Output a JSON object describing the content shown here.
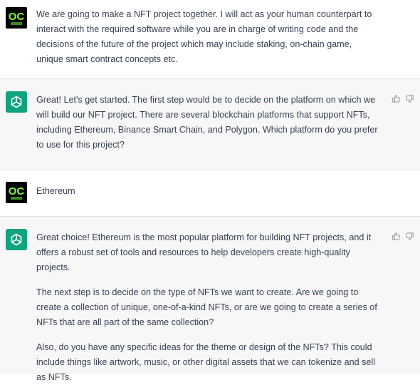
{
  "conversation": {
    "messages": [
      {
        "role": "user",
        "avatar": "user-avatar-oc",
        "paragraphs": [
          "We are going to make a NFT project together. I will act as your human counterpart to interact with the required software while you are in charge of writing code and the decisions of the future of the project which may include staking, on-chain game, unique smart contract concepts etc."
        ]
      },
      {
        "role": "assistant",
        "avatar": "chatgpt-logo-icon",
        "paragraphs": [
          "Great! Let's get started. The first step would be to decide on the platform on which we will build our NFT project. There are several blockchain platforms that support NFTs, including Ethereum, Binance Smart Chain, and Polygon. Which platform do you prefer to use for this project?"
        ]
      },
      {
        "role": "user",
        "avatar": "user-avatar-oc",
        "paragraphs": [
          "Ethereum"
        ]
      },
      {
        "role": "assistant",
        "avatar": "chatgpt-logo-icon",
        "paragraphs": [
          "Great choice! Ethereum is the most popular platform for building NFT projects, and it offers a robust set of tools and resources to help developers create high-quality projects.",
          "The next step is to decide on the type of NFTs we want to create. Are we going to create a collection of unique, one-of-a-kind NFTs, or are we going to create a series of NFTs that are all part of the same collection?",
          "Also, do you have any specific ideas for the theme or design of the NFTs? This could include things like artwork, music, or other digital assets that we can tokenize and sell as NFTs."
        ]
      }
    ]
  },
  "colors": {
    "assistant_bg": "#f7f7f8",
    "user_bg": "#ffffff",
    "chatgpt_green": "#10a37f",
    "avatar_letters": "#7fff3a"
  },
  "icons": {
    "like": "thumbs-up-icon",
    "dislike": "thumbs-down-icon"
  }
}
